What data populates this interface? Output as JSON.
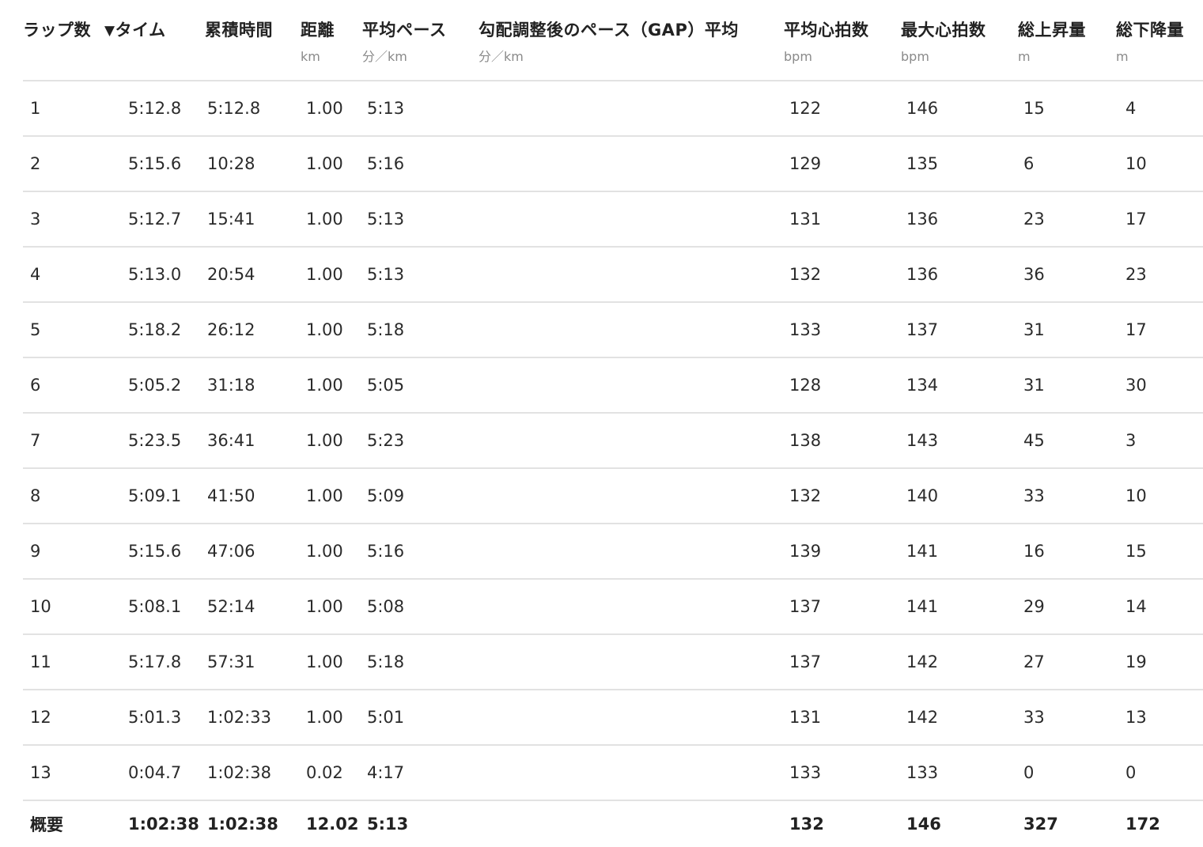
{
  "table": {
    "headers": [
      {
        "title": "ラップ数",
        "unit": ""
      },
      {
        "title": "タイム",
        "unit": "",
        "sort_indicator": "▼"
      },
      {
        "title": "累積時間",
        "unit": ""
      },
      {
        "title": "距離",
        "unit": "km"
      },
      {
        "title": "平均ペース",
        "unit": "分／km"
      },
      {
        "title": "勾配調整後のペース（GAP）平均",
        "unit": "分／km"
      },
      {
        "title": "平均心拍数",
        "unit": "bpm"
      },
      {
        "title": "最大心拍数",
        "unit": "bpm"
      },
      {
        "title": "総上昇量",
        "unit": "m"
      },
      {
        "title": "総下降量",
        "unit": "m"
      }
    ],
    "rows": [
      {
        "lap": "1",
        "time": "5:12.8",
        "cumulative": "5:12.8",
        "distance": "1.00",
        "pace": "5:13",
        "gap": "",
        "avg_hr": "122",
        "max_hr": "146",
        "ascent": "15",
        "descent": "4"
      },
      {
        "lap": "2",
        "time": "5:15.6",
        "cumulative": "10:28",
        "distance": "1.00",
        "pace": "5:16",
        "gap": "",
        "avg_hr": "129",
        "max_hr": "135",
        "ascent": "6",
        "descent": "10"
      },
      {
        "lap": "3",
        "time": "5:12.7",
        "cumulative": "15:41",
        "distance": "1.00",
        "pace": "5:13",
        "gap": "",
        "avg_hr": "131",
        "max_hr": "136",
        "ascent": "23",
        "descent": "17"
      },
      {
        "lap": "4",
        "time": "5:13.0",
        "cumulative": "20:54",
        "distance": "1.00",
        "pace": "5:13",
        "gap": "",
        "avg_hr": "132",
        "max_hr": "136",
        "ascent": "36",
        "descent": "23"
      },
      {
        "lap": "5",
        "time": "5:18.2",
        "cumulative": "26:12",
        "distance": "1.00",
        "pace": "5:18",
        "gap": "",
        "avg_hr": "133",
        "max_hr": "137",
        "ascent": "31",
        "descent": "17"
      },
      {
        "lap": "6",
        "time": "5:05.2",
        "cumulative": "31:18",
        "distance": "1.00",
        "pace": "5:05",
        "gap": "",
        "avg_hr": "128",
        "max_hr": "134",
        "ascent": "31",
        "descent": "30"
      },
      {
        "lap": "7",
        "time": "5:23.5",
        "cumulative": "36:41",
        "distance": "1.00",
        "pace": "5:23",
        "gap": "",
        "avg_hr": "138",
        "max_hr": "143",
        "ascent": "45",
        "descent": "3"
      },
      {
        "lap": "8",
        "time": "5:09.1",
        "cumulative": "41:50",
        "distance": "1.00",
        "pace": "5:09",
        "gap": "",
        "avg_hr": "132",
        "max_hr": "140",
        "ascent": "33",
        "descent": "10"
      },
      {
        "lap": "9",
        "time": "5:15.6",
        "cumulative": "47:06",
        "distance": "1.00",
        "pace": "5:16",
        "gap": "",
        "avg_hr": "139",
        "max_hr": "141",
        "ascent": "16",
        "descent": "15"
      },
      {
        "lap": "10",
        "time": "5:08.1",
        "cumulative": "52:14",
        "distance": "1.00",
        "pace": "5:08",
        "gap": "",
        "avg_hr": "137",
        "max_hr": "141",
        "ascent": "29",
        "descent": "14"
      },
      {
        "lap": "11",
        "time": "5:17.8",
        "cumulative": "57:31",
        "distance": "1.00",
        "pace": "5:18",
        "gap": "",
        "avg_hr": "137",
        "max_hr": "142",
        "ascent": "27",
        "descent": "19"
      },
      {
        "lap": "12",
        "time": "5:01.3",
        "cumulative": "1:02:33",
        "distance": "1.00",
        "pace": "5:01",
        "gap": "",
        "avg_hr": "131",
        "max_hr": "142",
        "ascent": "33",
        "descent": "13"
      },
      {
        "lap": "13",
        "time": "0:04.7",
        "cumulative": "1:02:38",
        "distance": "0.02",
        "pace": "4:17",
        "gap": "",
        "avg_hr": "133",
        "max_hr": "133",
        "ascent": "0",
        "descent": "0"
      }
    ],
    "summary": {
      "label": "概要",
      "time": "1:02:38",
      "cumulative": "1:02:38",
      "distance": "12.02",
      "pace": "5:13",
      "gap": "",
      "avg_hr": "132",
      "max_hr": "146",
      "ascent": "327",
      "descent": "172"
    }
  }
}
